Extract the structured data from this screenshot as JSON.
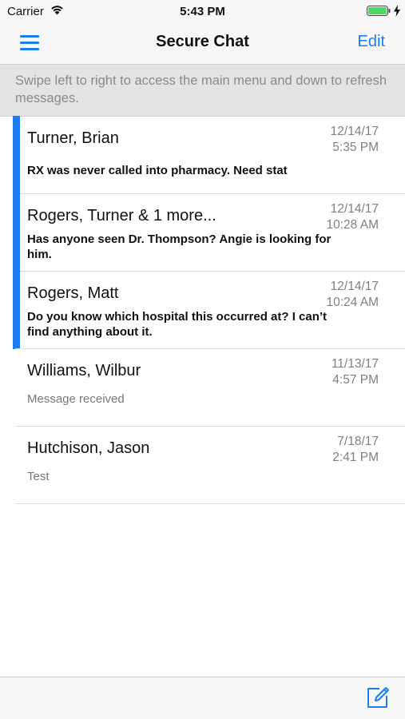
{
  "status_bar": {
    "carrier": "Carrier",
    "time": "5:43 PM",
    "battery_color": "#4cd964"
  },
  "nav": {
    "title": "Secure Chat",
    "edit_label": "Edit",
    "accent_color": "#1a7ef0"
  },
  "hint": {
    "text": "Swipe left to right to access the main menu and down to refresh messages."
  },
  "chats": [
    {
      "name": "Turner, Brian",
      "date": "12/14/17",
      "time": "5:35 PM",
      "message": "RX was never called into pharmacy. Need stat",
      "unread": true
    },
    {
      "name": "Rogers, Turner & 1 more...",
      "date": "12/14/17",
      "time": "10:28 AM",
      "message": "Has anyone seen Dr. Thompson? Angie is looking for him.",
      "unread": true
    },
    {
      "name": "Rogers, Matt",
      "date": "12/14/17",
      "time": "10:24 AM",
      "message": "Do you know which hospital this occurred at? I can’t find anything about it.",
      "unread": true
    },
    {
      "name": "Williams, Wilbur",
      "date": "11/13/17",
      "time": "4:57 PM",
      "message": "Message received",
      "unread": false
    },
    {
      "name": "Hutchison, Jason",
      "date": "7/18/17",
      "time": "2:41 PM",
      "message": "Test",
      "unread": false
    }
  ],
  "toolbar": {
    "compose_icon": "compose-icon"
  }
}
